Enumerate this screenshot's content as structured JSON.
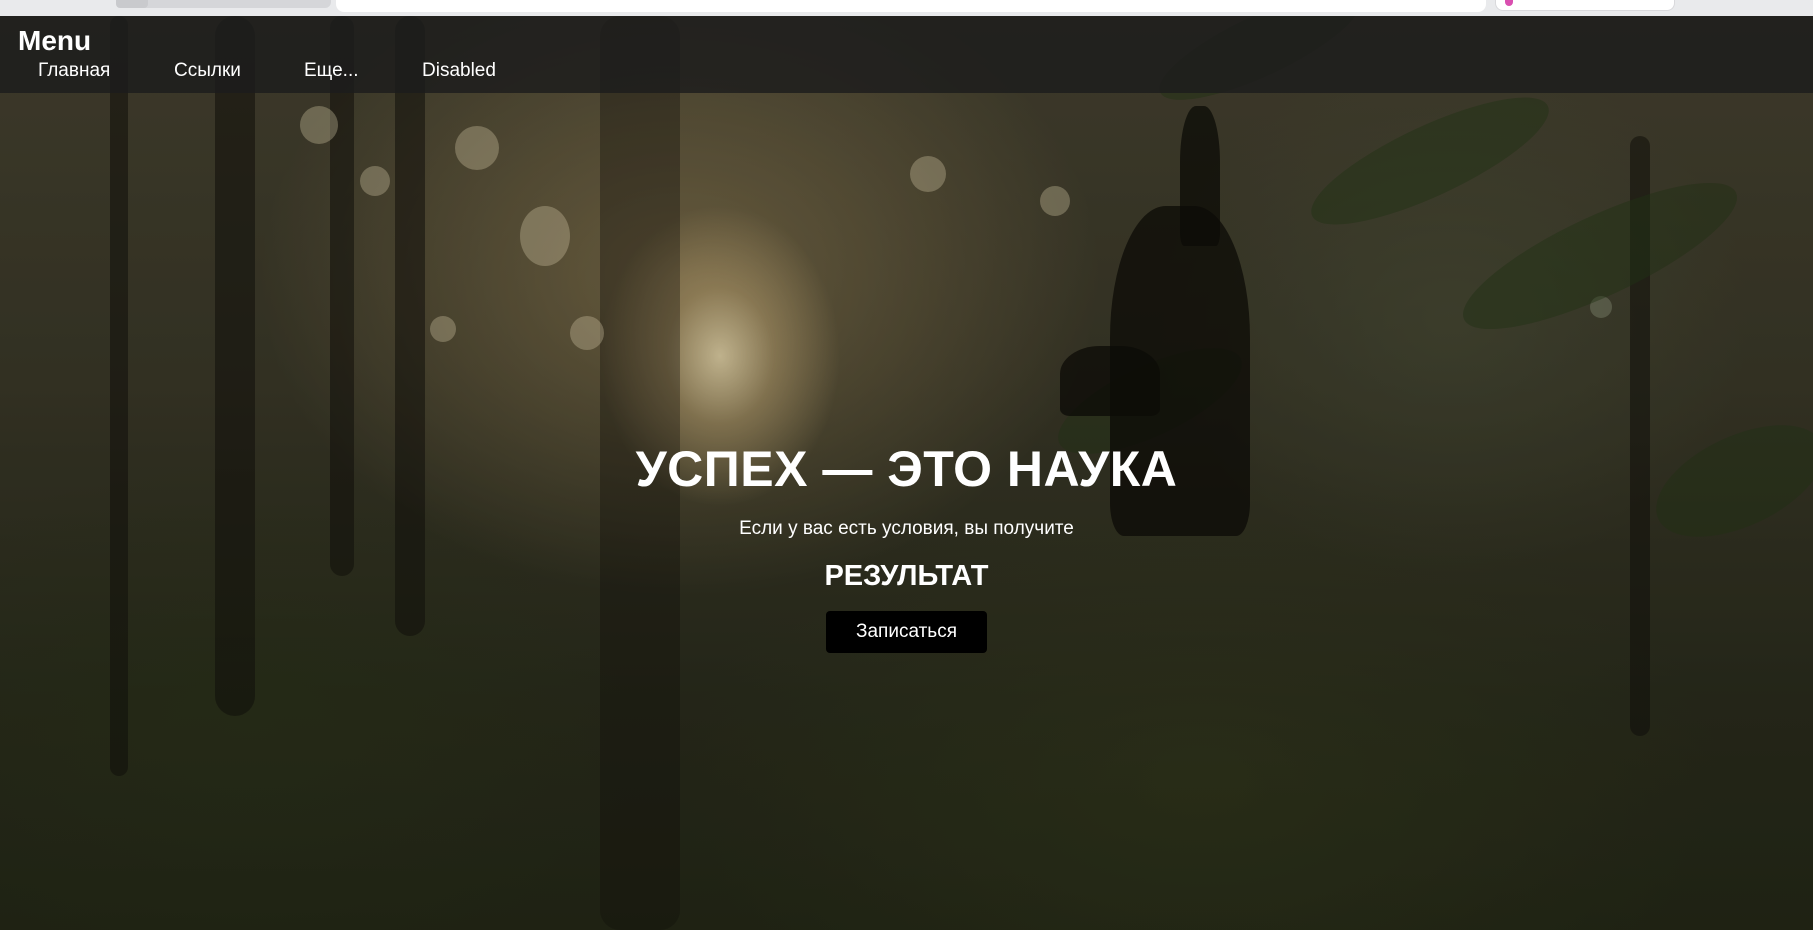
{
  "navbar": {
    "brand": "Menu",
    "links": [
      "Главная",
      "Ссылки",
      "Еще...",
      "Disabled"
    ]
  },
  "hero": {
    "headline": "УСПЕХ — ЭТО НАУКА",
    "subtitle": "Если у вас есть условия, вы получите",
    "result": "РЕЗУЛЬТАТ",
    "cta_label": "Записаться"
  },
  "colors": {
    "navbar_bg": "#1c1c1c",
    "cta_bg": "#000000",
    "text": "#ffffff"
  }
}
